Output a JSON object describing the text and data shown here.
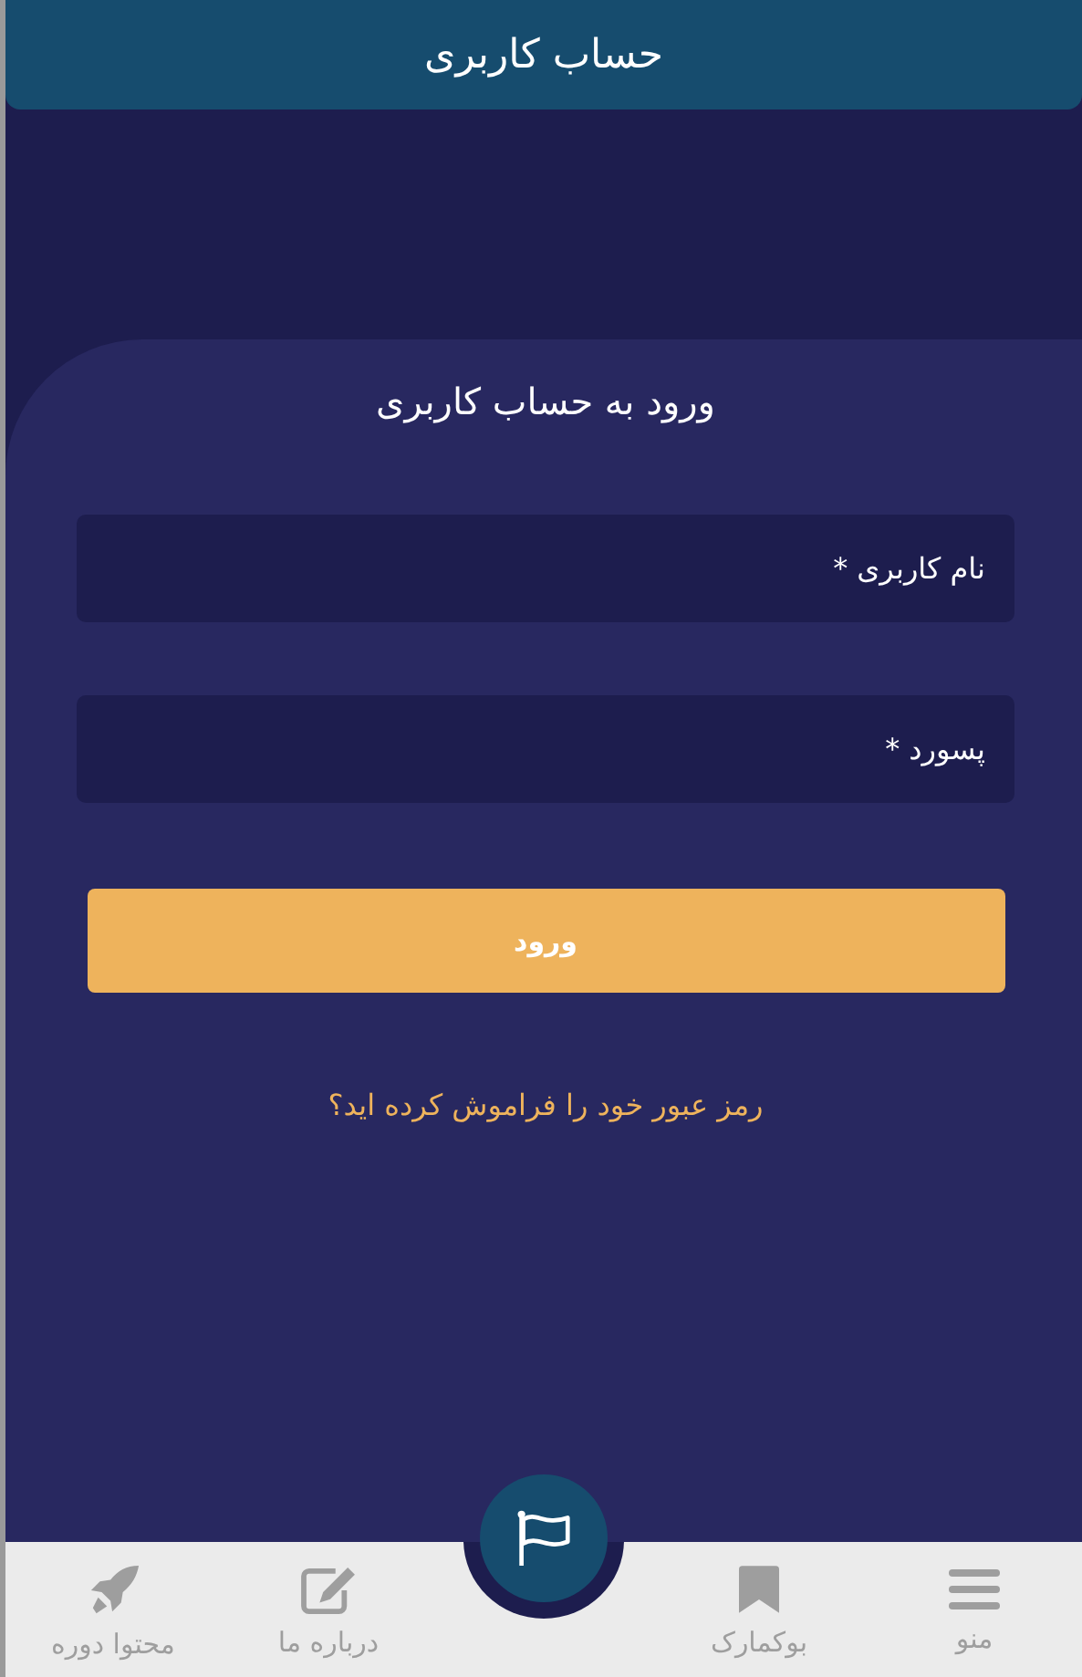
{
  "header": {
    "title": "حساب کاربری"
  },
  "login": {
    "title": "ورود به حساب کاربری",
    "fields": [
      {
        "placeholder": "نام کاربری *"
      },
      {
        "placeholder": "پسورد *"
      }
    ],
    "submit": "ورود",
    "forgot_link": "رمز عبور خود را فراموش کرده اید؟"
  },
  "bottom_nav": [
    {
      "label": "منو",
      "kind": "menu"
    },
    {
      "label": "بوکمارک",
      "kind": "bookmark"
    },
    {
      "kind": "center"
    },
    {
      "label": "درباره ما",
      "kind": "edit"
    },
    {
      "label": "محتوا دوره",
      "kind": "rocket"
    }
  ]
}
